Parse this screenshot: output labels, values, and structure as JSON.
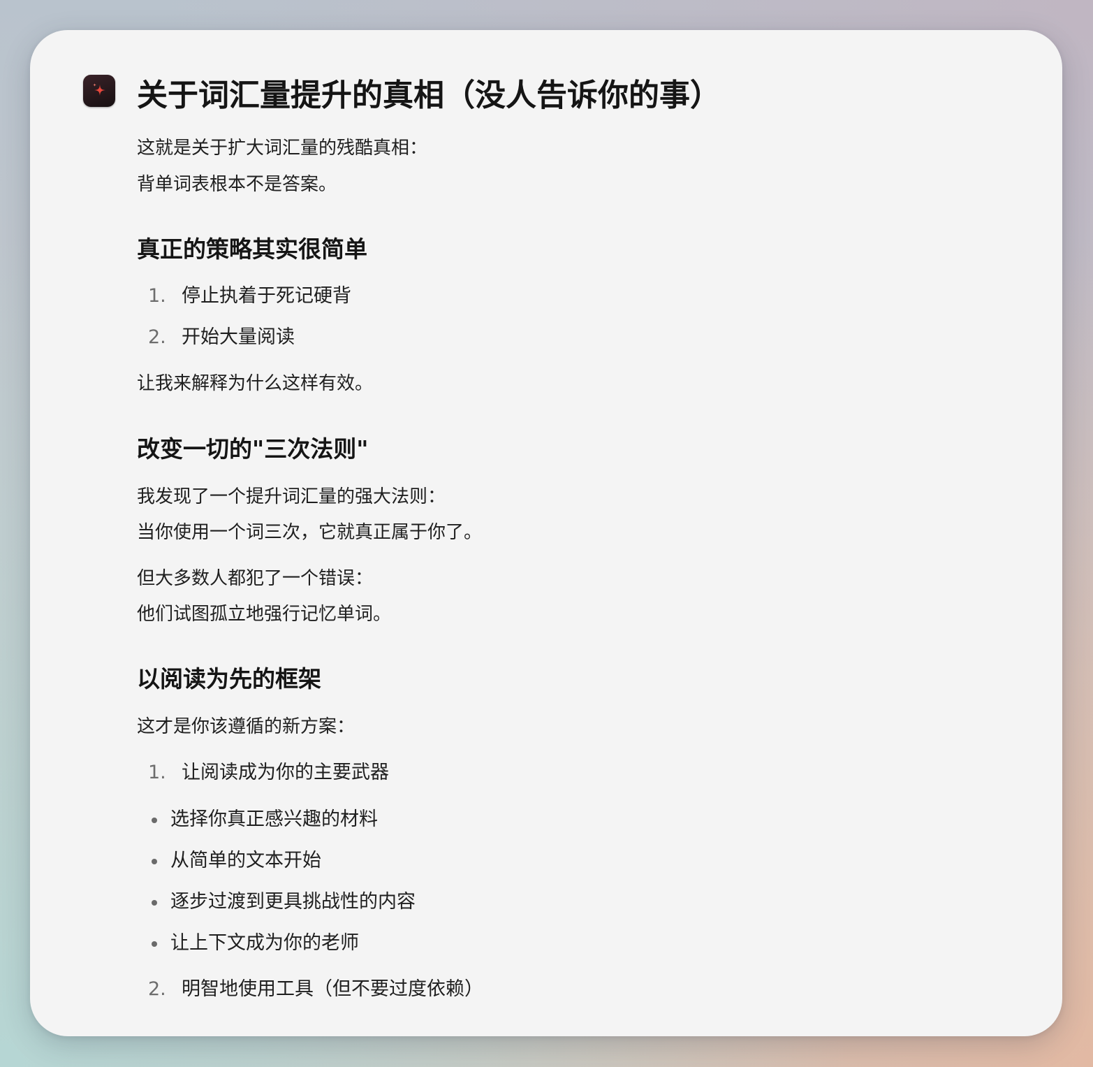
{
  "title": "关于词汇量提升的真相（没人告诉你的事）",
  "app_icon": "sparkle-icon",
  "intro": [
    "这就是关于扩大词汇量的残酷真相：",
    "背单词表根本不是答案。"
  ],
  "section1": {
    "heading": "真正的策略其实很简单",
    "list": [
      {
        "num": "1.",
        "text": "停止执着于死记硬背"
      },
      {
        "num": "2.",
        "text": "开始大量阅读"
      }
    ],
    "after": "让我来解释为什么这样有效。"
  },
  "section2": {
    "heading": "改变一切的\"三次法则\"",
    "para1": [
      "我发现了一个提升词汇量的强大法则：",
      "当你使用一个词三次，它就真正属于你了。"
    ],
    "para2": [
      "但大多数人都犯了一个错误：",
      "他们试图孤立地强行记忆单词。"
    ]
  },
  "section3": {
    "heading": "以阅读为先的框架",
    "intro": "这才是你该遵循的新方案：",
    "item1": {
      "num": "1.",
      "text": "让阅读成为你的主要武器"
    },
    "bullets": [
      "选择你真正感兴趣的材料",
      "从简单的文本开始",
      "逐步过渡到更具挑战性的内容",
      "让上下文成为你的老师"
    ],
    "item2": {
      "num": "2.",
      "text": "明智地使用工具（但不要过度依赖）"
    }
  },
  "colors": {
    "card_background": "#f4f4f4",
    "text": "#1f1f1f",
    "list_marker": "#6d6d6d",
    "icon_background": "#1f1416",
    "icon_sparkle": "#e8473c"
  }
}
